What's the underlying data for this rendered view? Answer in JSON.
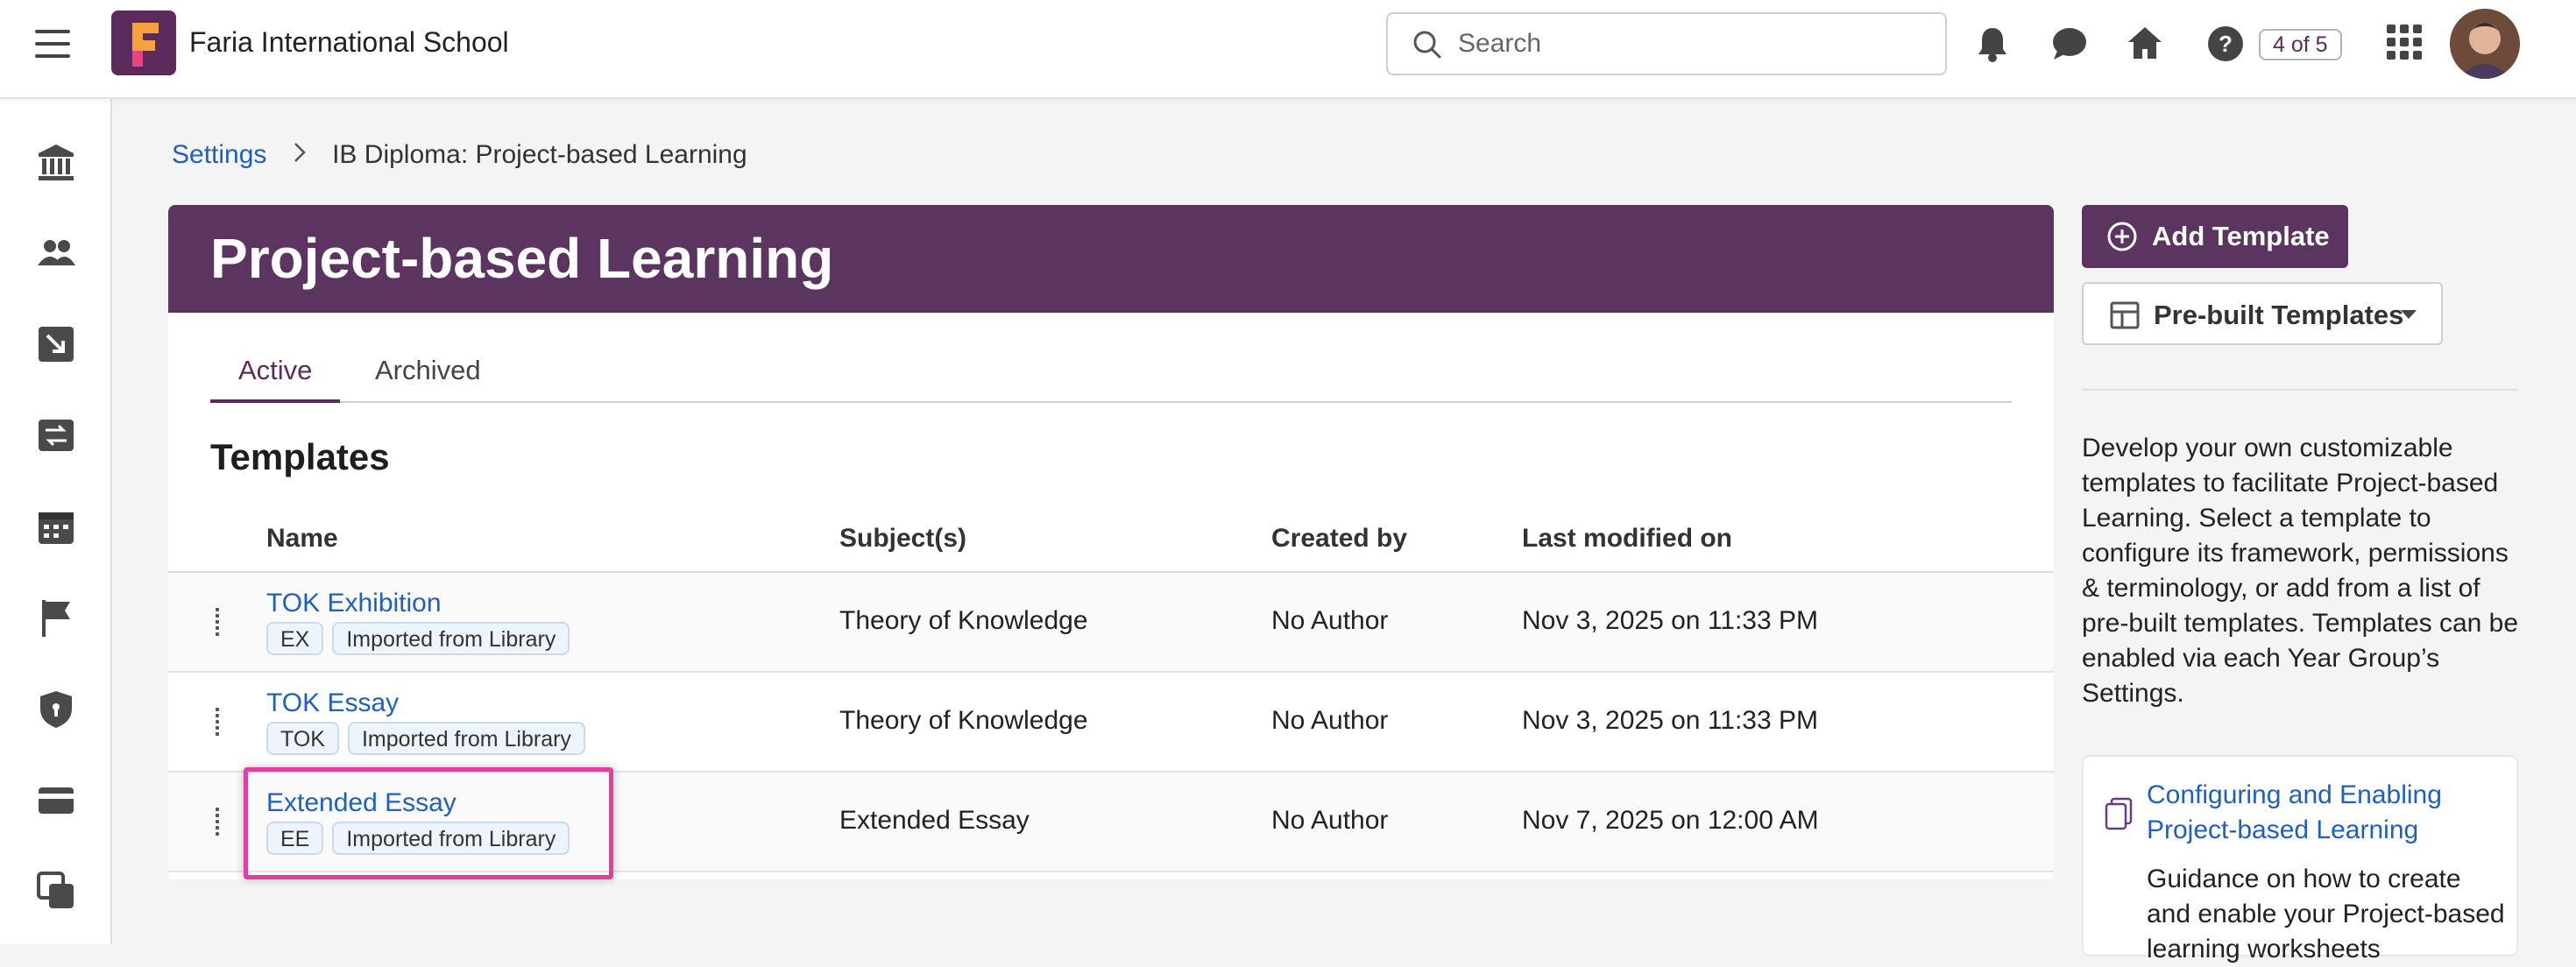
{
  "topbar": {
    "school_name": "Faria International School",
    "search_placeholder": "Search",
    "counter": "4 of 5"
  },
  "breadcrumb": {
    "parent": "Settings",
    "current": "IB Diploma: Project-based Learning"
  },
  "page": {
    "title": "Project-based Learning",
    "tabs": [
      {
        "label": "Active",
        "active": true
      },
      {
        "label": "Archived",
        "active": false
      }
    ],
    "section_title": "Templates"
  },
  "table": {
    "headers": {
      "name": "Name",
      "subjects": "Subject(s)",
      "created_by": "Created by",
      "modified": "Last modified on"
    },
    "rows": [
      {
        "name": "TOK Exhibition",
        "tags": [
          "EX",
          "Imported from Library"
        ],
        "subjects": "Theory of Knowledge",
        "created_by": "No Author",
        "modified": "Nov 3, 2025 on 11:33 PM"
      },
      {
        "name": "TOK Essay",
        "tags": [
          "TOK",
          "Imported from Library"
        ],
        "subjects": "Theory of Knowledge",
        "created_by": "No Author",
        "modified": "Nov 3, 2025 on 11:33 PM"
      },
      {
        "name": "Extended Essay",
        "tags": [
          "EE",
          "Imported from Library"
        ],
        "subjects": "Extended Essay",
        "created_by": "No Author",
        "modified": "Nov 7, 2025 on 12:00 AM"
      }
    ]
  },
  "right_panel": {
    "add_template": "Add Template",
    "prebuilt_templates": "Pre-built Templates",
    "help_text": "Develop your own customizable templates to facilitate Project-based Learning. Select a template to configure its framework, permissions & terminology, or add from a list of pre-built templates. Templates can be enabled via each Year Group’s Settings.",
    "guide_link": "Configuring and Enabling Project-based Learning",
    "guide_desc": "Guidance on how to create and enable your Project-based learning worksheets"
  },
  "colors": {
    "brand": "#5c3460",
    "link": "#1f5fbf",
    "highlight": "#e23ea1"
  },
  "icons": {
    "sidebar": [
      "institution-icon",
      "people-icon",
      "import-icon",
      "sync-icon",
      "calendar-icon",
      "flag-icon",
      "shield-icon",
      "card-icon",
      "copy-icon"
    ],
    "top": [
      "bell-icon",
      "chat-icon",
      "home-icon",
      "help-icon",
      "apps-grid-icon"
    ]
  }
}
